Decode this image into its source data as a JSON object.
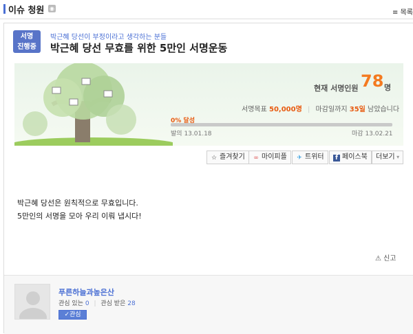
{
  "header": {
    "title": "이슈 청원",
    "list_label": "≡ 목록"
  },
  "petition": {
    "status_badge_line1": "서명",
    "status_badge_line2": "진행중",
    "subtitle": "박근혜 당선이 부정이라고 생각하는 분들",
    "title": "박근혜 당선 무효를 위한 5만인 서명운동",
    "current_label": "현재 서명인원",
    "current_count": "78",
    "current_unit": "명",
    "goal_label": "서명목표",
    "goal_value": "50,000명",
    "deadline_text_prefix": "마감일까지",
    "deadline_days": "35일",
    "deadline_text_suffix": "남았습니다",
    "progress_label": "0% 달성",
    "progress_percent": 0,
    "start_label": "발의",
    "start_date": "13.01.18",
    "end_label": "마감",
    "end_date": "13.02.21",
    "body_line1": "박근혜 당선은 원칙적으로 무효입니다.",
    "body_line2": "5만인의 서명을 모아 우리 이뤄 냅시다!",
    "report_label": "신고"
  },
  "share": {
    "favorite": "즐겨찾기",
    "mypeople": "마이피플",
    "twitter": "트위터",
    "facebook": "페이스북",
    "more": "더보기"
  },
  "user": {
    "name": "푸른하늘과높은산",
    "interest_label": "관심 있는",
    "interest_count": "0",
    "interested_label": "관심 받은",
    "interested_count": "28",
    "follow_label": "관심"
  },
  "colors": {
    "accent": "#4a6fd4",
    "badge": "#5874c8",
    "count": "#f47a20"
  }
}
